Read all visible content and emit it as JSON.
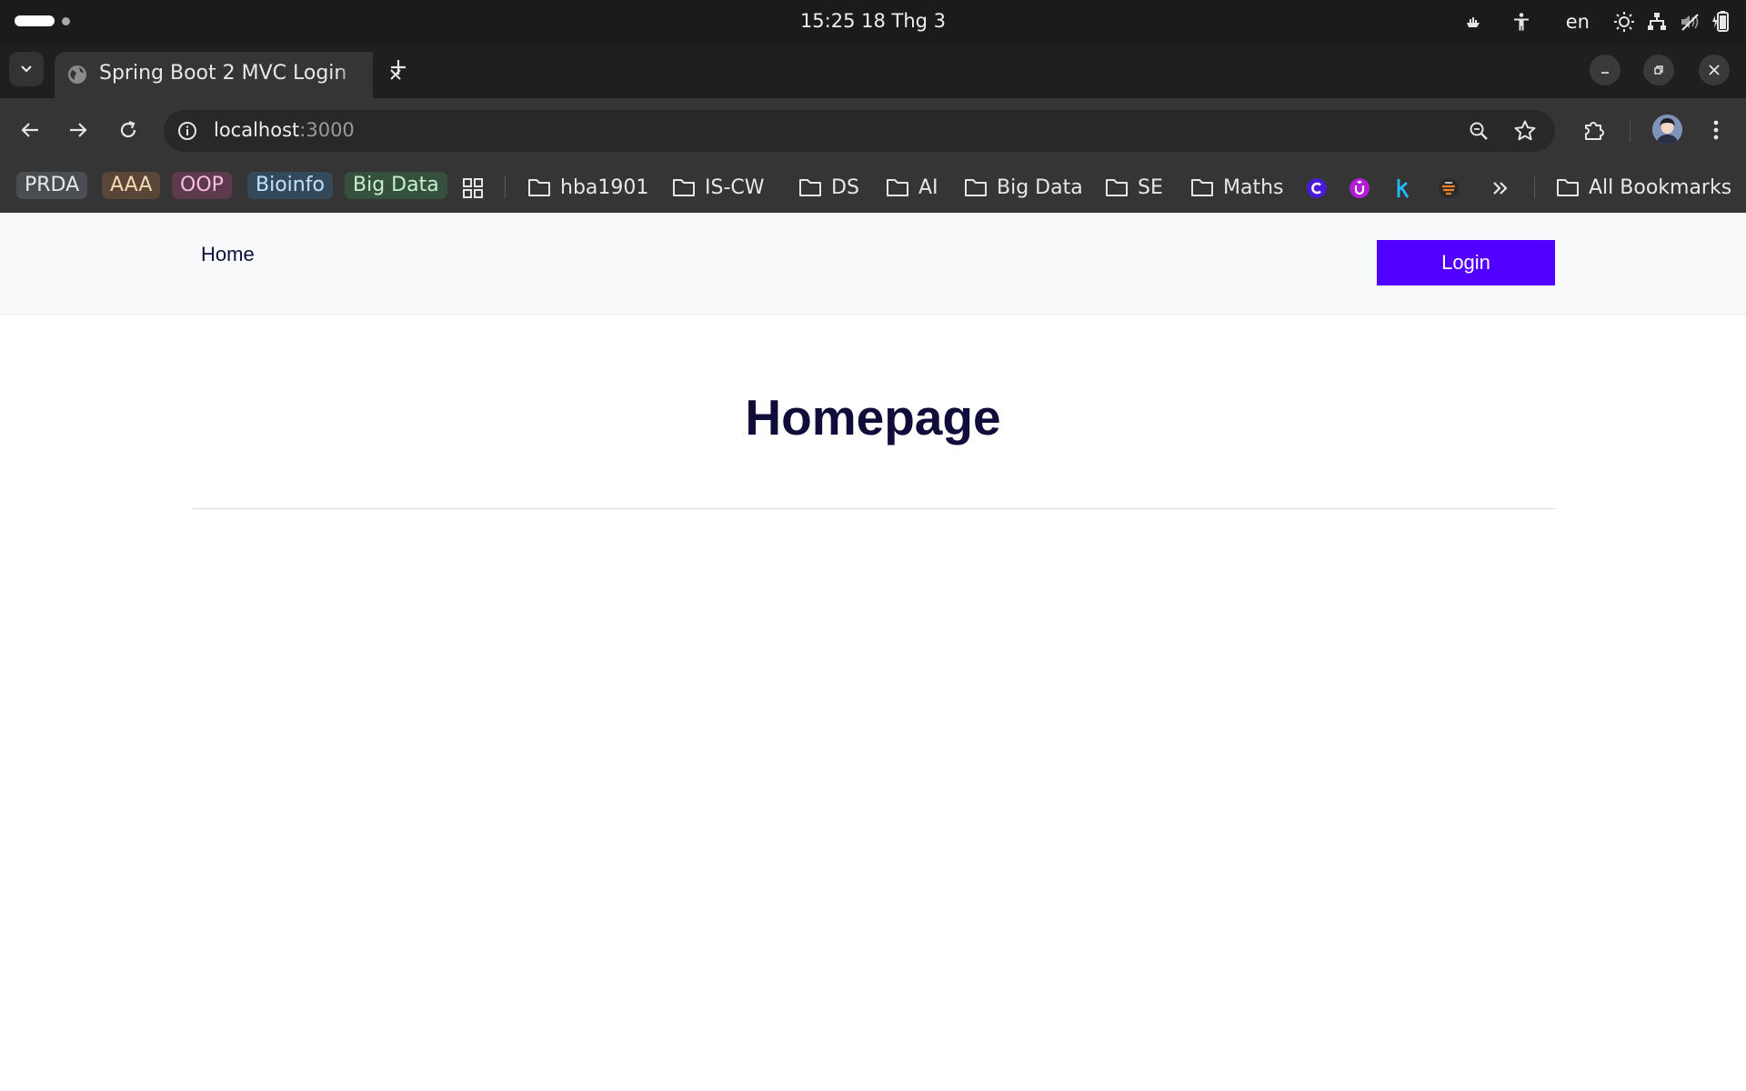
{
  "system_bar": {
    "clock": "15:25  18 Thg 3",
    "language": "en"
  },
  "browser": {
    "tab_title": "Spring Boot 2 MVC Login",
    "address": {
      "host": "localhost",
      "port": ":3000"
    },
    "bookmarks_bar": {
      "chips": [
        {
          "label": "PRDA",
          "bg": "#4a4d52",
          "color": "#e8e8e8"
        },
        {
          "label": "AAA",
          "bg": "#5a4636",
          "color": "#f5d9b8"
        },
        {
          "label": "OOP",
          "bg": "#5d3a4c",
          "color": "#f7bfd9"
        },
        {
          "label": "Bioinfo",
          "bg": "#34495a",
          "color": "#bfe3ff"
        },
        {
          "label": "Big Data",
          "bg": "#36503e",
          "color": "#c4f0cc"
        }
      ],
      "folders": [
        "hba1901",
        "IS-CW",
        "DS",
        "AI",
        "Big Data",
        "SE",
        "Maths"
      ],
      "all_bookmarks": "All Bookmarks"
    }
  },
  "page": {
    "nav": {
      "home_label": "Home",
      "login_label": "Login"
    },
    "heading": "Homepage"
  },
  "colors": {
    "login_button": "#5200ff",
    "heading": "#110d3a"
  }
}
